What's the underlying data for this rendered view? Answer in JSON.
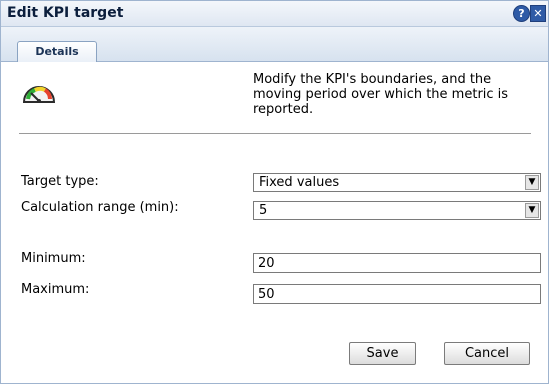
{
  "dialog": {
    "title": "Edit KPI target",
    "help_glyph": "?",
    "close_glyph": "✕"
  },
  "tabs": [
    {
      "label": "Details",
      "active": true
    }
  ],
  "icon": {
    "name": "gauge-icon"
  },
  "description": "Modify the KPI's boundaries, and the moving period over which the metric is reported.",
  "form": {
    "target_type": {
      "label": "Target type:",
      "value": "Fixed values"
    },
    "calculation_range": {
      "label": "Calculation range (min):",
      "value": "5"
    },
    "minimum": {
      "label": "Minimum:",
      "value": "20"
    },
    "maximum": {
      "label": "Maximum:",
      "value": "50"
    }
  },
  "buttons": {
    "save": "Save",
    "cancel": "Cancel"
  },
  "colors": {
    "title_text": "#0b1e3c",
    "border": "#9fb4cf",
    "help_blue": "#2f5ba6"
  }
}
